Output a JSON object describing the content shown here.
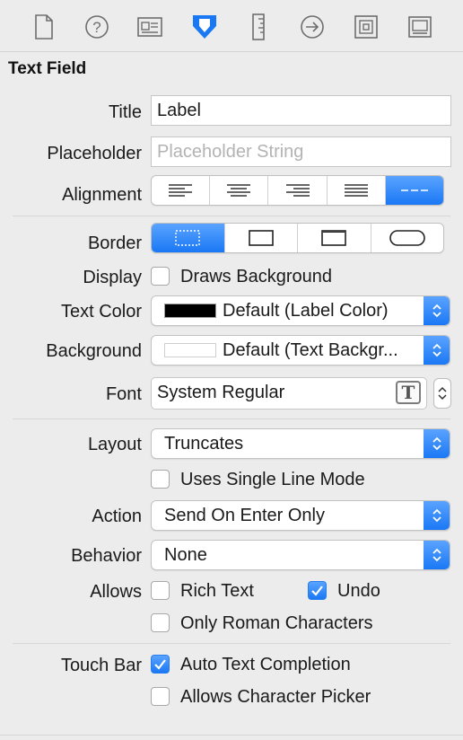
{
  "toolbar": {
    "icons": [
      "file-inspector-icon",
      "quick-help-icon",
      "identity-inspector-icon",
      "attributes-inspector-icon",
      "size-inspector-icon",
      "connections-inspector-icon",
      "bindings-inspector-icon",
      "view-effects-inspector-icon"
    ],
    "selected": "attributes-inspector-icon",
    "accent_color": "#1a78f5"
  },
  "section": {
    "title": "Text Field"
  },
  "title_field": {
    "label": "Title",
    "value": "Label"
  },
  "placeholder_field": {
    "label": "Placeholder",
    "placeholder": "Placeholder String"
  },
  "alignment": {
    "label": "Alignment",
    "options": [
      "left",
      "center",
      "right",
      "justified",
      "natural"
    ],
    "selected": "natural"
  },
  "border": {
    "label": "Border",
    "options": [
      "none",
      "line",
      "bezel",
      "rounded"
    ],
    "selected": "none"
  },
  "display": {
    "label": "Display",
    "checkbox_label": "Draws Background",
    "checked": false
  },
  "text_color": {
    "label": "Text Color",
    "value": "Default (Label Color)",
    "swatch": "#000000"
  },
  "background": {
    "label": "Background",
    "value": "Default (Text Backgr...",
    "swatch": "#ffffff"
  },
  "font": {
    "label": "Font",
    "value": "System Regular"
  },
  "layout": {
    "label": "Layout",
    "value": "Truncates"
  },
  "single_line": {
    "label": "Uses Single Line Mode",
    "checked": false
  },
  "action": {
    "label": "Action",
    "value": "Send On Enter Only"
  },
  "behavior": {
    "label": "Behavior",
    "value": "None"
  },
  "allows": {
    "label": "Allows",
    "rich_text": {
      "label": "Rich Text",
      "checked": false
    },
    "undo": {
      "label": "Undo",
      "checked": true
    },
    "only_roman": {
      "label": "Only Roman Characters",
      "checked": false
    }
  },
  "touch_bar": {
    "label": "Touch Bar",
    "auto_completion": {
      "label": "Auto Text Completion",
      "checked": true
    },
    "character_picker": {
      "label": "Allows Character Picker",
      "checked": false
    }
  }
}
